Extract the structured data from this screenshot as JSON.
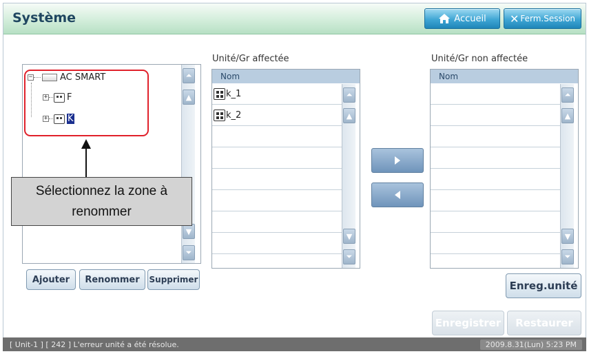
{
  "header": {
    "title": "Système",
    "home_label": "Accueil",
    "logout_label": "Ferm.Session"
  },
  "tree": {
    "root_label": "AC SMART",
    "nodes": [
      {
        "label": "F",
        "selected": false
      },
      {
        "label": "K",
        "selected": true
      }
    ],
    "buttons": {
      "add": "Ajouter",
      "rename": "Renommer",
      "delete": "Supprimer"
    }
  },
  "callout": {
    "text": "Sélectionnez la zone à renommer"
  },
  "assigned": {
    "title": "Unité/Gr affectée",
    "column": "Nom",
    "items": [
      "k_1",
      "k_2"
    ]
  },
  "unassigned": {
    "title": "Unité/Gr non affectée",
    "column": "Nom",
    "items": []
  },
  "actions": {
    "save_unit": "Enreg.unité",
    "save": "Enregistrer",
    "restore": "Restaurer"
  },
  "status": {
    "message": "[ Unit-1 ] [ 242 ] L'erreur unité a été résolue.",
    "datetime": "2009.8.31(Lun)  5:23 PM"
  },
  "colors": {
    "highlight": "#e0202a",
    "selection": "#1a2f8f",
    "header_button": "#3fa6d4"
  }
}
